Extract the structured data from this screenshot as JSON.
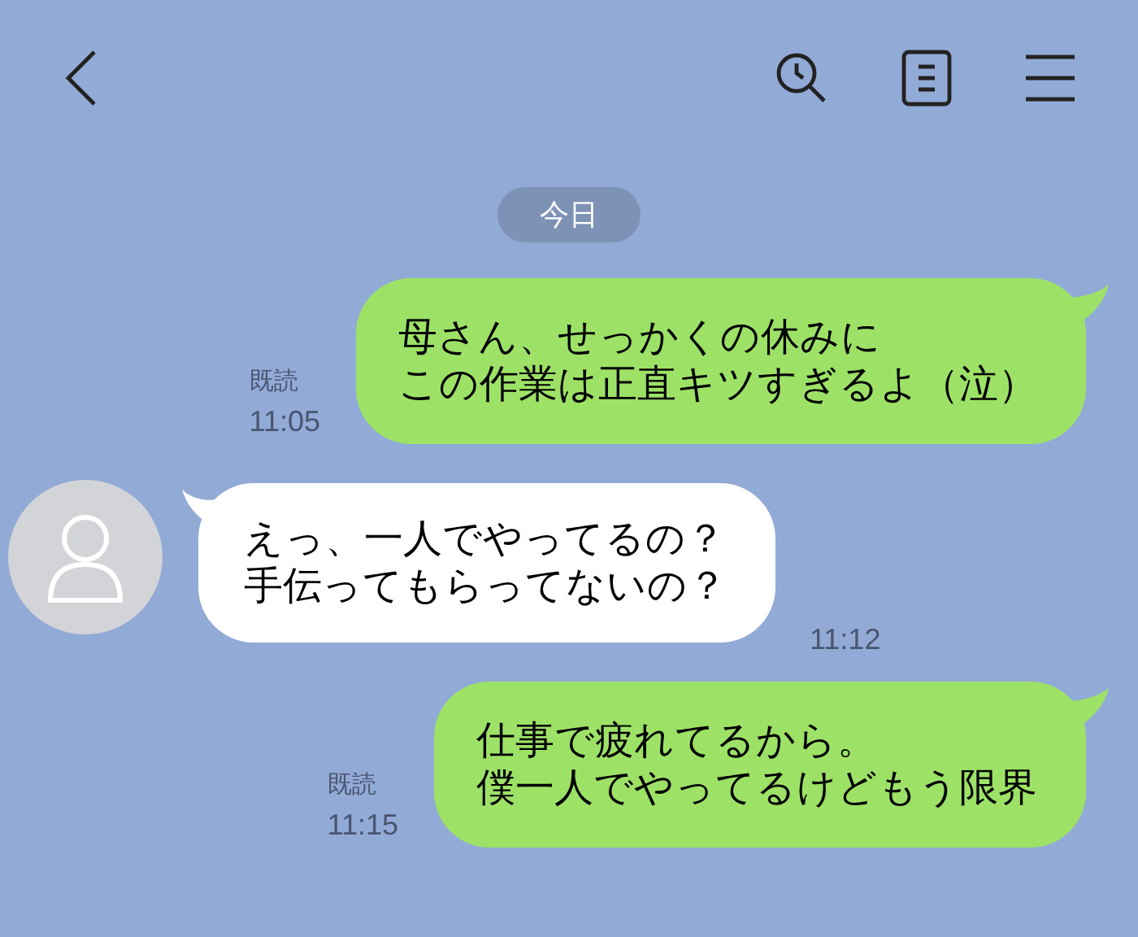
{
  "header": {
    "actions": [
      {
        "kind": "search"
      },
      {
        "kind": "notes"
      },
      {
        "kind": "menu"
      }
    ]
  },
  "date_label": "今日",
  "messages": [
    {
      "kind": "sent",
      "lines": [
        "母さん、せっかくの休みに",
        "この作業は正直キツすぎるよ（泣）"
      ],
      "read": "既読",
      "time": "11:05"
    },
    {
      "kind": "received",
      "lines": [
        "えっ、一人でやってるの？",
        "手伝ってもらってないの？"
      ],
      "time": "11:12"
    },
    {
      "kind": "sent",
      "lines": [
        "仕事で疲れてるから。",
        "僕一人でやってるけどもう限界"
      ],
      "read": "既読",
      "time": "11:15"
    }
  ]
}
